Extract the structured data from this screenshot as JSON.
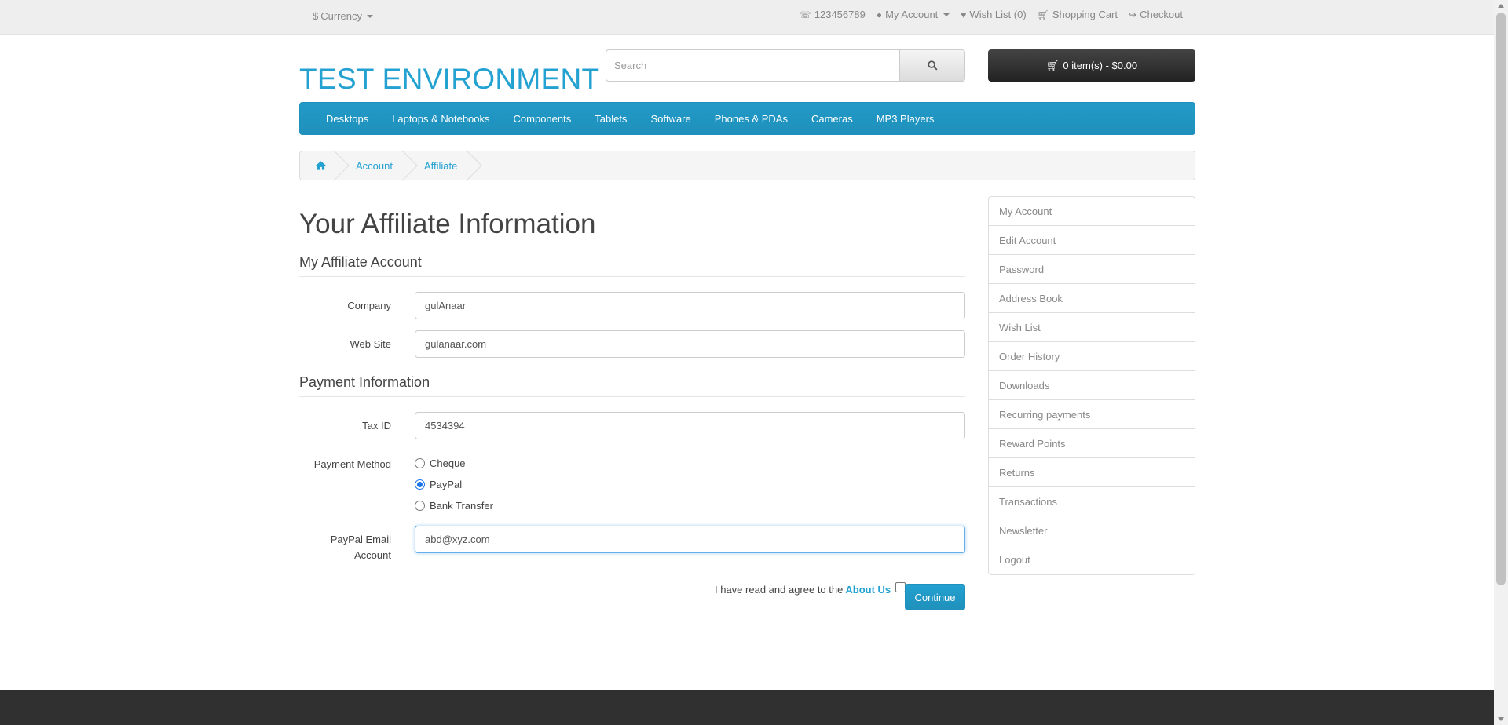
{
  "topbar": {
    "currency_label": "Currency",
    "phone": "123456789",
    "my_account": "My Account",
    "wishlist": "Wish List (0)",
    "cart": "Shopping Cart",
    "checkout": "Checkout"
  },
  "header": {
    "logo": "TEST ENVIRONMENT",
    "search_placeholder": "Search",
    "cart_summary": "0 item(s) - $0.00"
  },
  "menu": [
    "Desktops",
    "Laptops & Notebooks",
    "Components",
    "Tablets",
    "Software",
    "Phones & PDAs",
    "Cameras",
    "MP3 Players"
  ],
  "breadcrumb": [
    "Account",
    "Affiliate"
  ],
  "main": {
    "title": "Your Affiliate Information",
    "section_account": "My Affiliate Account",
    "company_label": "Company",
    "company_value": "gulAnaar",
    "website_label": "Web Site",
    "website_value": "gulanaar.com",
    "section_payment": "Payment Information",
    "taxid_label": "Tax ID",
    "taxid_value": "4534394",
    "payment_method_label": "Payment Method",
    "payment_options": [
      "Cheque",
      "PayPal",
      "Bank Transfer"
    ],
    "payment_selected": "PayPal",
    "paypal_label_line1": "PayPal Email",
    "paypal_label_line2": "Account",
    "paypal_value": "abd@xyz.com",
    "agree_text": "I have read and agree to the",
    "agree_link": "About Us",
    "continue": "Continue"
  },
  "sidebar": [
    "My Account",
    "Edit Account",
    "Password",
    "Address Book",
    "Wish List",
    "Order History",
    "Downloads",
    "Recurring payments",
    "Reward Points",
    "Returns",
    "Transactions",
    "Newsletter",
    "Logout"
  ]
}
